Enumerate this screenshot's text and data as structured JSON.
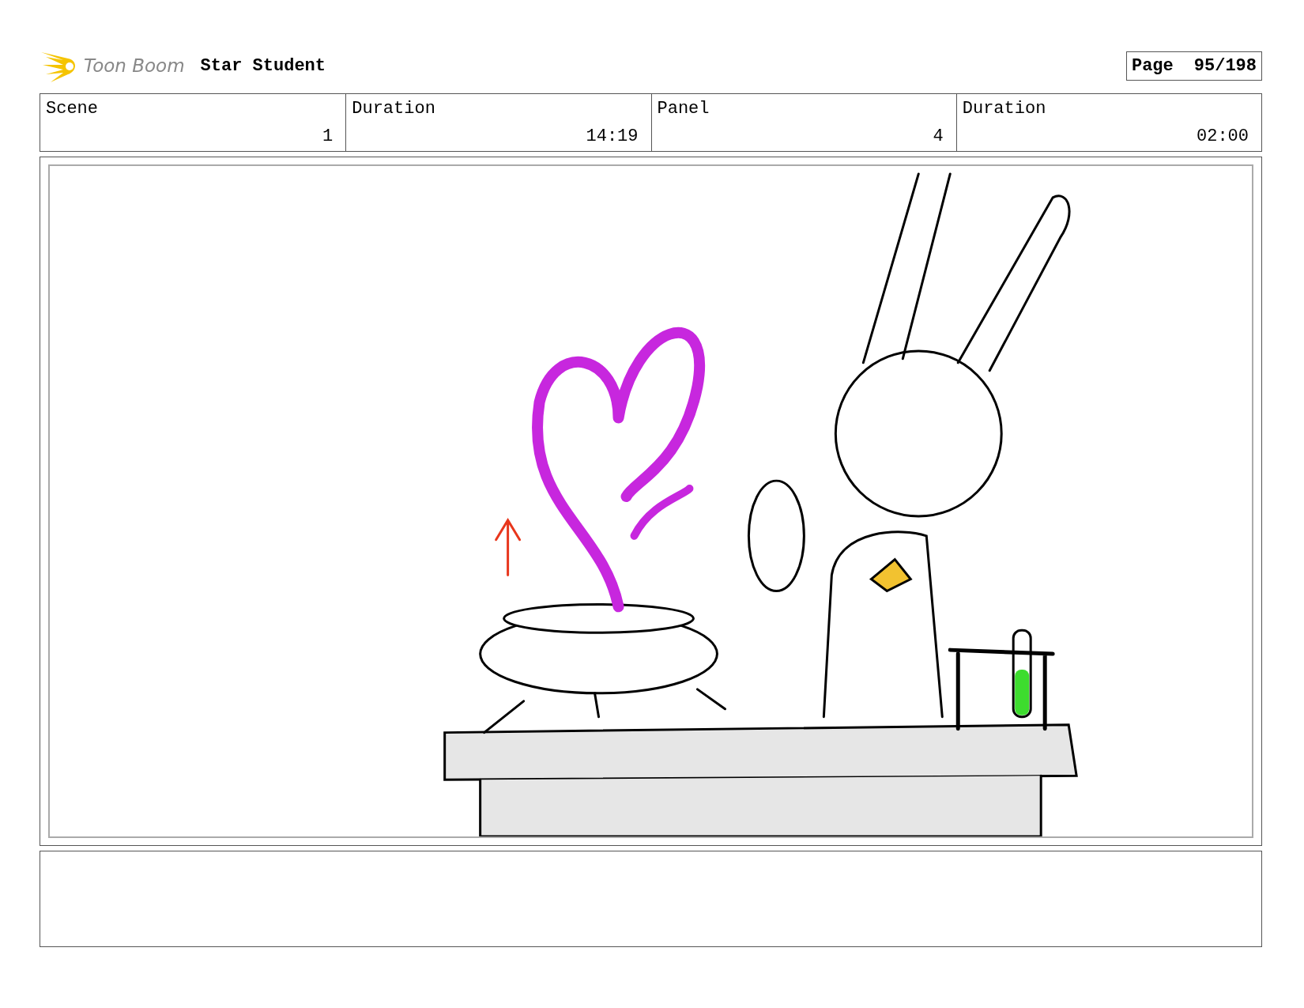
{
  "header": {
    "logo": "Toon Boom",
    "title": "Star Student",
    "page_label": "Page",
    "page": "95/198"
  },
  "fields": [
    {
      "label": "Scene",
      "value": "1"
    },
    {
      "label": "Duration",
      "value": "14:19"
    },
    {
      "label": "Panel",
      "value": "4"
    },
    {
      "label": "Duration",
      "value": "02:00"
    }
  ]
}
